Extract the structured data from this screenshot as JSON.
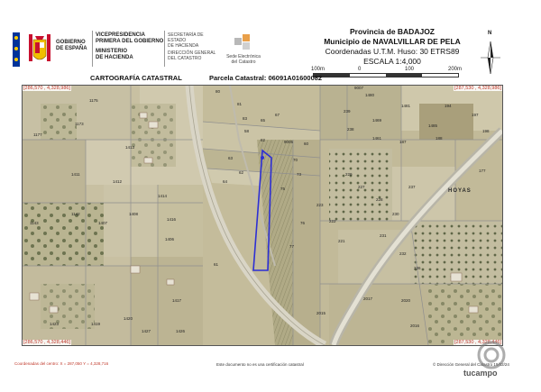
{
  "header": {
    "gov_lines": [
      "GOBIERNO",
      "DE ESPAÑA"
    ],
    "vp_lines": [
      "VICEPRESIDENCIA",
      "PRIMERA DEL GOBIERNO"
    ],
    "min_lines": [
      "MINISTERIO",
      "DE HACIENDA"
    ],
    "sec_lines": [
      "SECRETARÍA DE ESTADO",
      "DE HACIENDA"
    ],
    "dir_lines": [
      "DIRECCIÓN GENERAL",
      "DEL CATASTRO"
    ],
    "sede_lines": [
      "Sede Electrónica",
      "del Catastro"
    ],
    "province": "Provincia de BADAJOZ",
    "municipality": "Municipio de NAVALVILLAR DE PELA",
    "coords_system": "Coordenadas U.T.M. Huso: 30 ETRS89",
    "scale": "ESCALA 1:4,000",
    "scale_ticks": [
      "100m",
      "0",
      "100",
      "200m"
    ],
    "north_label": "N",
    "left_caption": "CARTOGRAFÍA CATASTRAL",
    "parcel_caption": "Parcela Catastral: 06091A01600082"
  },
  "map": {
    "coord_tl": "[286,570 , 4,328,986]",
    "coord_tr": "[287,530 , 4,328,986]",
    "coord_bl": "[286,570 , 4,328,446]",
    "coord_br": "[287,530 , 4,328,446]",
    "place_label": "HOYAS",
    "parcel_labels": [
      "1177",
      "1173",
      "1175",
      "1413",
      "1412",
      "1411",
      "1408",
      "1407",
      "1416",
      "1414",
      "1143",
      "1142",
      "1406",
      "1417",
      "1420",
      "1419",
      "1423",
      "1426",
      "1427",
      "80",
      "81",
      "82",
      "83",
      "64",
      "62",
      "63",
      "221",
      "222",
      "223",
      "227",
      "228",
      "229",
      "230",
      "231",
      "232",
      "236",
      "237",
      "238",
      "239",
      "1469",
      "1461",
      "1480",
      "1481",
      "1485",
      "187",
      "188",
      "177",
      "194",
      "197",
      "198",
      "9007",
      "9005",
      "70",
      "73",
      "75",
      "76",
      "77",
      "65",
      "67",
      "58",
      "60",
      "61",
      "2015",
      "2016",
      "2017",
      "2020",
      "2021"
    ]
  },
  "footer": {
    "center_coords": "Coordenadas del centro: X = 287,050 Y = 4,328,716",
    "notice": "Este documento no es una certificación catastral",
    "copyright": "© Dirección General del Catastro 19/02/24",
    "watermark": "tucampo"
  },
  "colors": {
    "gov_red": "#c8102e",
    "gov_yellow": "#f1bf00",
    "parcel_outline": "#2d2fd4",
    "coord_red": "#c0392b"
  }
}
